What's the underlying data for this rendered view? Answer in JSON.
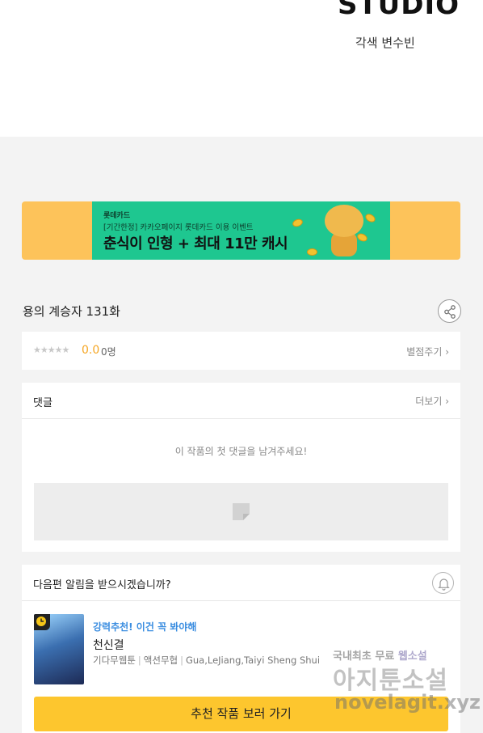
{
  "header": {
    "studio_logo": "STUDIO",
    "credit": "각색 변수빈"
  },
  "banner": {
    "brand": "롯데카드",
    "subtitle": "[기간한정] 카카오페이지 롯데카드 이용 이벤트",
    "title": "춘식이 인형 + 최대 11만 캐시",
    "colors": {
      "outer": "#fdc35a",
      "inner": "#1ec790"
    }
  },
  "episode": {
    "title": "용의 계승자 131화",
    "share_icon": "share-icon"
  },
  "rating": {
    "stars": "★★★★★",
    "score": "0.0",
    "count": "0명",
    "rate_label": "별점주기 ›"
  },
  "comments": {
    "label": "댓글",
    "more_label": "더보기 ›",
    "empty_message": "이 작품의 첫 댓글을 남겨주세요!"
  },
  "notify": {
    "question": "다음편 알림을 받으시겠습니까?",
    "bell_icon": "bell-icon"
  },
  "recommend": {
    "tag": "강력추천! 이건 꼭 봐야해",
    "name": "천신결",
    "status": "기다무웹툰",
    "genre": "액션무협",
    "authors": "Gua,LeJiang,Taiyi Sheng Shui",
    "cta_label": "추천 작품 보러 가기",
    "cta_color": "#fdc62e"
  },
  "watermark": {
    "line1_a": "국내최초 무료 ",
    "line1_b": "웹소설",
    "line2": "아지툰소설",
    "line3": "novelagit.xyz"
  }
}
